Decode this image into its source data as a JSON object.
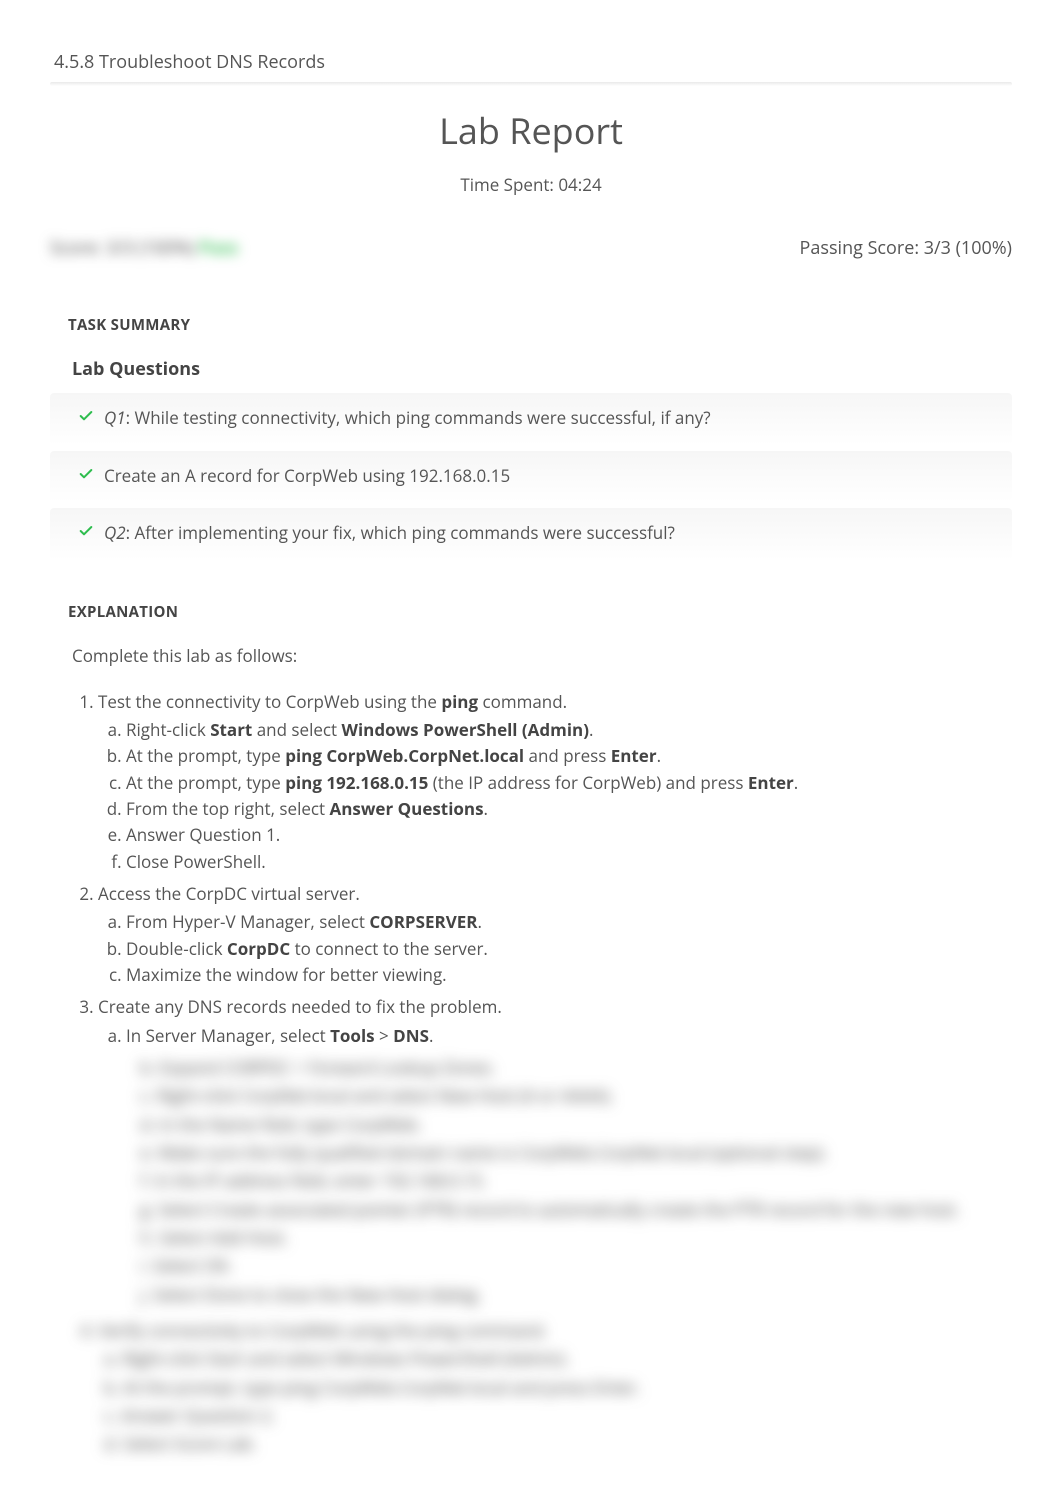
{
  "header": {
    "breadcrumb": "4.5.8 Troubleshoot DNS Records",
    "title": "Lab Report",
    "time_spent_label": "Time Spent: 04:24"
  },
  "score": {
    "blurred_left_a": "Score: 3/3 (100%) ",
    "blurred_left_b": "Pass",
    "passing": "Passing Score: 3/3 (100%)"
  },
  "task_summary": {
    "heading": "TASK SUMMARY",
    "lab_questions_heading": "Lab Questions",
    "items": [
      {
        "q_label": "Q1",
        "text": ":  While testing connectivity, which ping commands were successful, if any?"
      },
      {
        "q_label": "",
        "text": "Create an A record for CorpWeb using 192.168.0.15"
      },
      {
        "q_label": "Q2",
        "text": ":  After implementing your fix, which ping commands were successful?"
      }
    ]
  },
  "explanation": {
    "heading": "EXPLANATION",
    "intro": "Complete this lab as follows:",
    "step1_intro_a": "Test the connectivity to CorpWeb using the ",
    "step1_intro_b": "ping",
    "step1_intro_c": " command.",
    "step1a_a": "Right-click ",
    "step1a_b": "Start",
    "step1a_c": " and select ",
    "step1a_d": "Windows PowerShell (Admin)",
    "step1a_e": ".",
    "step1b_a": "At the prompt, type ",
    "step1b_b": "ping CorpWeb.CorpNet.local",
    "step1b_c": " and press ",
    "step1b_d": "Enter",
    "step1b_e": ".",
    "step1c_a": "At the prompt, type ",
    "step1c_b": "ping 192.168.0.15",
    "step1c_c": " (the IP address for CorpWeb) and press ",
    "step1c_d": "Enter",
    "step1c_e": ".",
    "step1d_a": "From the top right, select ",
    "step1d_b": "Answer Questions",
    "step1d_c": ".",
    "step1e": "Answer Question 1.",
    "step1f": "Close PowerShell.",
    "step2_intro": "Access the CorpDC virtual server.",
    "step2a_a": "From Hyper-V Manager, select ",
    "step2a_b": "CORPSERVER",
    "step2a_c": ".",
    "step2b_a": "Double-click ",
    "step2b_b": "CorpDC",
    "step2b_c": " to connect to the server.",
    "step2c": "Maximize the window for better viewing.",
    "step3_intro": "Create any DNS records needed to fix the problem.",
    "step3a_a": "In Server Manager, select ",
    "step3a_b": "Tools",
    "step3a_c": " > ",
    "step3a_d": "DNS",
    "step3a_e": ".",
    "blurred_lines": [
      "b. Expand CORPDC > Forward Lookup Zones.",
      "c. Right-click CorpNet.local and select New Host (A or AAAA).",
      "d. In the Name field, type CorpWeb.",
      "e. Make sure the fully qualified domain name is CorpWeb.CorpNet.local (optional step).",
      "f. In the IP address field, enter 192.168.0.15.",
      "g. Select Create associated pointer (PTR) record to automatically create the PTR record for the new host.",
      "h. Select Add Host.",
      "i. Select OK.",
      "j. Select Done to close the New Host dialog."
    ],
    "blurred_step4": [
      "4. Verify connectivity to CorpWeb using the ping command.",
      "a. Right-click Start and select Windows PowerShell (Admin).",
      "b. At the prompt, type ping CorpWeb.CorpNet.local and press Enter.",
      "c. Answer Question 2.",
      "d. Select Score Lab."
    ]
  }
}
